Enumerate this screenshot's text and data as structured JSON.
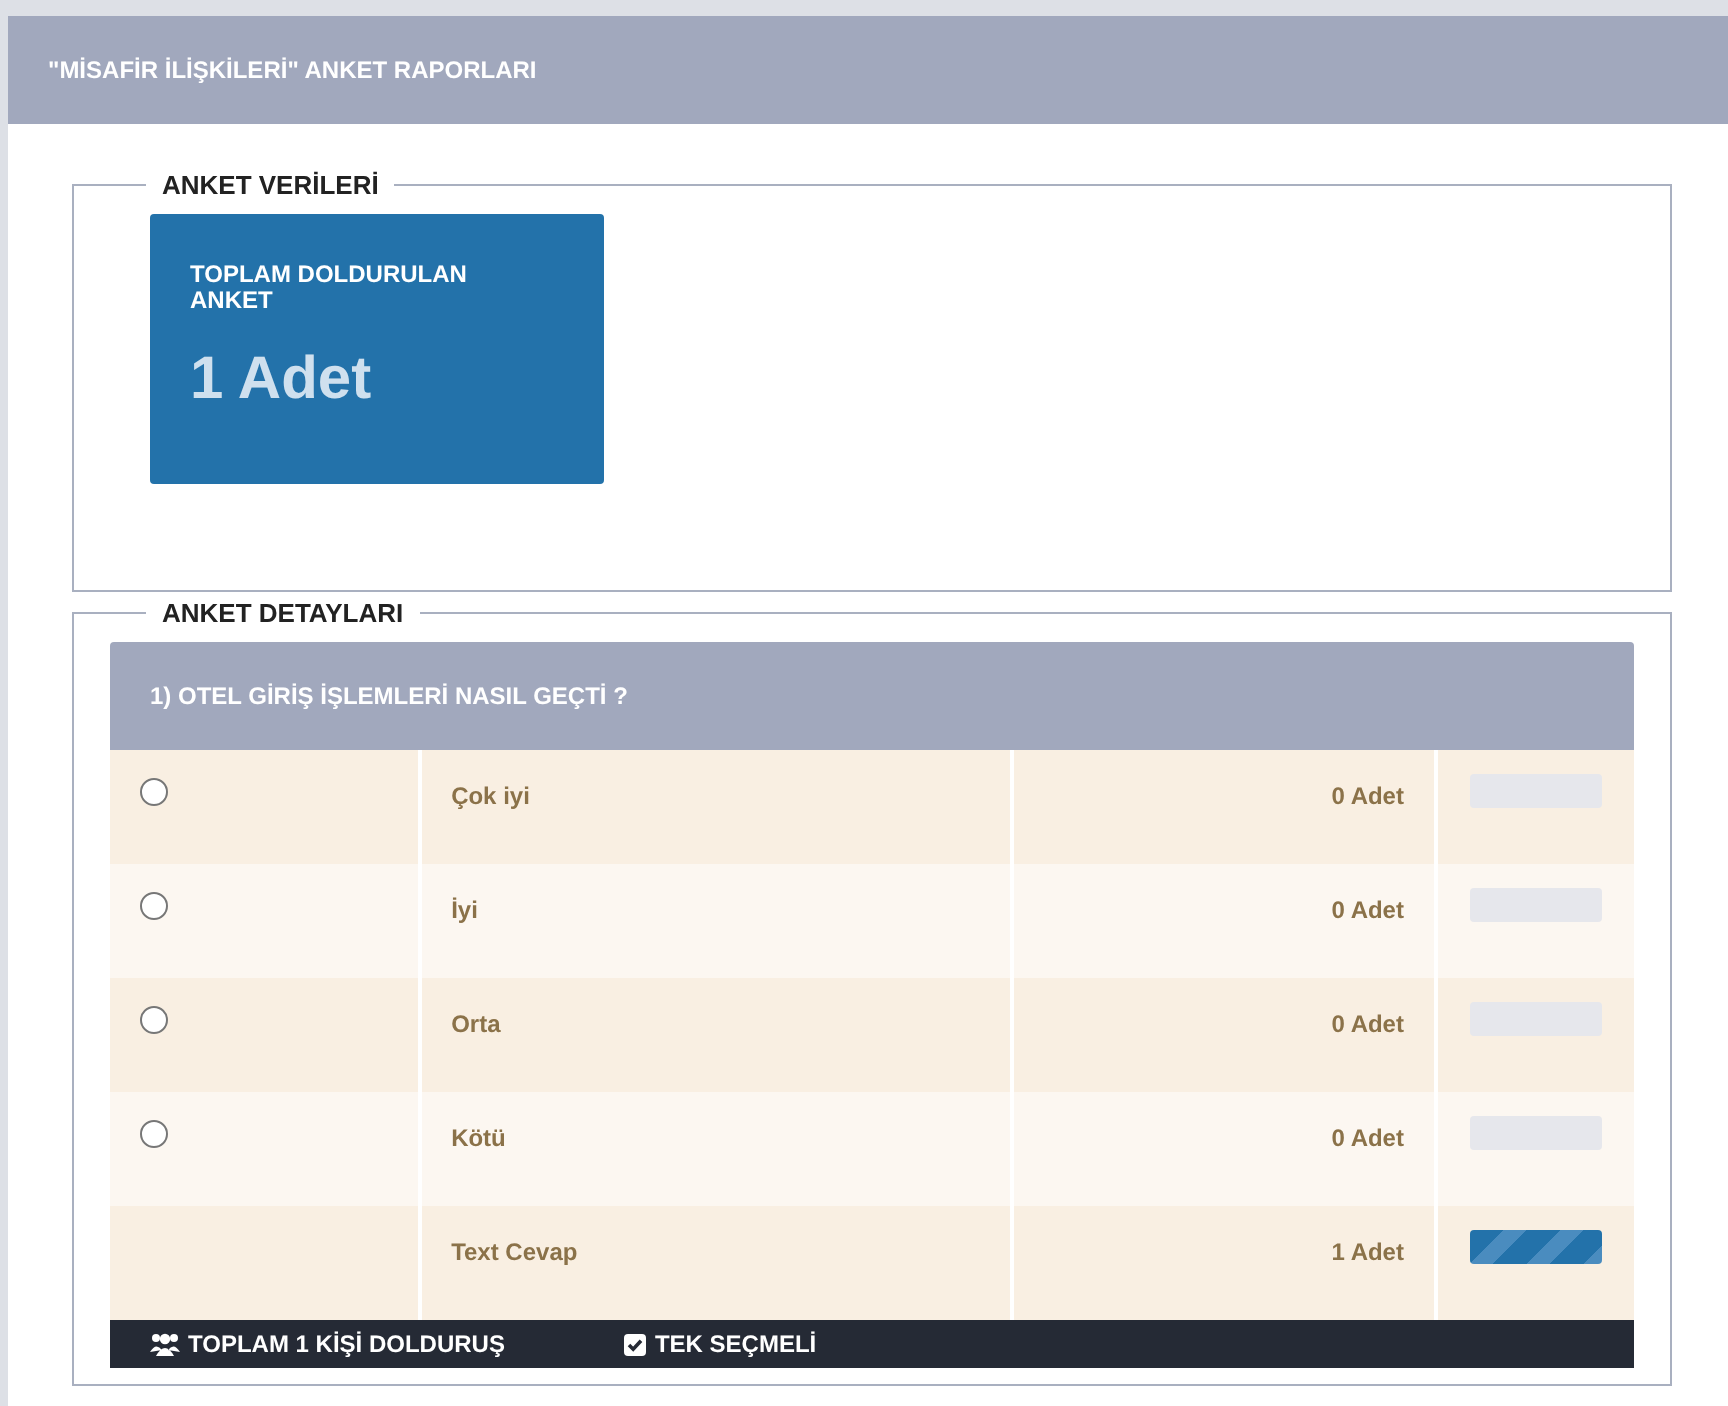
{
  "header": {
    "title": "\"MİSAFİR İLİŞKİLERİ\" ANKET RAPORLARI"
  },
  "survey_data": {
    "legend": "ANKET VERİLERİ",
    "stat": {
      "label": "TOPLAM DOLDURULAN ANKET",
      "value": "1 Adet"
    }
  },
  "survey_details": {
    "legend": "ANKET DETAYLARI",
    "question": {
      "title": "1) OTEL GİRİŞ İŞLEMLERİ NASIL GEÇTİ ?",
      "answers": [
        {
          "kind": "radio",
          "checked": false,
          "label": "Çok iyi",
          "count": "0 Adet",
          "level": 0
        },
        {
          "kind": "radio",
          "checked": false,
          "label": "İyi",
          "count": "0 Adet",
          "level": 0
        },
        {
          "kind": "radio",
          "checked": false,
          "label": "Orta",
          "count": "0 Adet",
          "level": 0
        },
        {
          "kind": "radio",
          "checked": false,
          "label": "Kötü",
          "count": "0 Adet",
          "level": 0
        },
        {
          "kind": "text",
          "label": "Text Cevap",
          "count": "1 Adet",
          "level": 1
        }
      ],
      "footer": {
        "respondents": "TOPLAM 1 KİŞİ DOLDURUŞ",
        "type": "TEK SEÇMELİ"
      }
    }
  }
}
